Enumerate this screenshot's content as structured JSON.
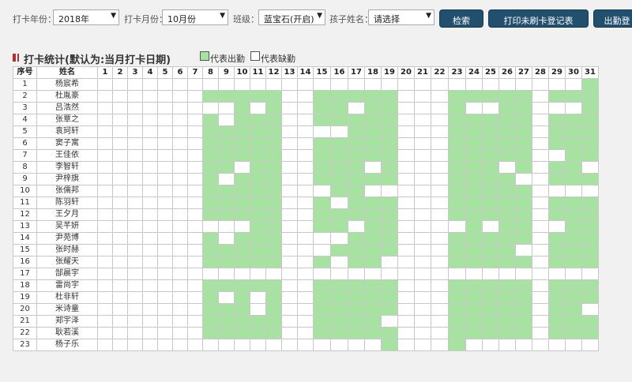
{
  "filters": {
    "year_label": "打卡年份：",
    "year_value": "2018年",
    "month_label": "打卡月份：",
    "month_value": "10月份",
    "class_label": "班级：",
    "class_value": "蓝宝石(开启)",
    "child_label": "孩子姓名：",
    "child_value": "请选择"
  },
  "buttons": {
    "search": "检索",
    "print": "打印未刷卡登记表",
    "export": "出勤登"
  },
  "section": {
    "title": "打卡统计(默认为:当月打卡日期)",
    "legend_present": "代表出勤",
    "legend_absent": "代表缺勤"
  },
  "colors": {
    "present": "#a6e3a1",
    "absent": "#ffffff",
    "button": "#21506e"
  },
  "table": {
    "col_seq": "序号",
    "col_name": "姓名",
    "days": [
      "1",
      "2",
      "3",
      "4",
      "5",
      "6",
      "7",
      "8",
      "9",
      "10",
      "11",
      "12",
      "13",
      "14",
      "15",
      "16",
      "17",
      "18",
      "19",
      "20",
      "21",
      "22",
      "23",
      "24",
      "25",
      "26",
      "27",
      "28",
      "29",
      "30",
      "31"
    ],
    "rows": [
      {
        "seq": "1",
        "name": "杨宸希",
        "att": "0000000000000000000000000000001"
      },
      {
        "seq": "2",
        "name": "杜胤豪",
        "att": "0000000111110011111000111110111"
      },
      {
        "seq": "3",
        "name": "吕浩然",
        "att": "0000000001010011011000100110001"
      },
      {
        "seq": "4",
        "name": "张覃之",
        "att": "0000000101110011111000111110111"
      },
      {
        "seq": "5",
        "name": "袁珂轩",
        "att": "0000000111110000111000111110111"
      },
      {
        "seq": "6",
        "name": "窦子寓",
        "att": "0000000111110011111000111110111"
      },
      {
        "seq": "7",
        "name": "王佳依",
        "att": "0000000111110011111000111110011"
      },
      {
        "seq": "8",
        "name": "李智轩",
        "att": "0000000110110011101000111010110"
      },
      {
        "seq": "9",
        "name": "尹梓旗",
        "att": "0000000101110011111000111100111"
      },
      {
        "seq": "10",
        "name": "张儒邦",
        "att": "0000000111110001100000111110000"
      },
      {
        "seq": "11",
        "name": "陈羽轩",
        "att": "0000000111110010111000111110111"
      },
      {
        "seq": "12",
        "name": "王夕月",
        "att": "0000000111110011111000111110111"
      },
      {
        "seq": "13",
        "name": "吴芊妍",
        "att": "0000000000110011011000010110011"
      },
      {
        "seq": "14",
        "name": "尹苑博",
        "att": "0000000101110000111000111110111"
      },
      {
        "seq": "15",
        "name": "张时赫",
        "att": "0000000111110001111000111100111"
      },
      {
        "seq": "16",
        "name": "张耀天",
        "att": "0000000111110010110000111110111"
      },
      {
        "seq": "17",
        "name": "郜晨宇",
        "att": "0000000000000000000000000000000"
      },
      {
        "seq": "18",
        "name": "雷尚宇",
        "att": "0000000111110011111000111110111"
      },
      {
        "seq": "19",
        "name": "杜非轩",
        "att": "0000000101010011111000111110111"
      },
      {
        "seq": "20",
        "name": "米诗童",
        "att": "0000000111010011111000111110110"
      },
      {
        "seq": "21",
        "name": "郑宇泽",
        "att": "0000000111110011110000111110111"
      },
      {
        "seq": "22",
        "name": "耿若溪",
        "att": "0000000111110011111000111110111"
      },
      {
        "seq": "23",
        "name": "杨子乐",
        "att": "0000000000000000001000100000000"
      }
    ]
  }
}
